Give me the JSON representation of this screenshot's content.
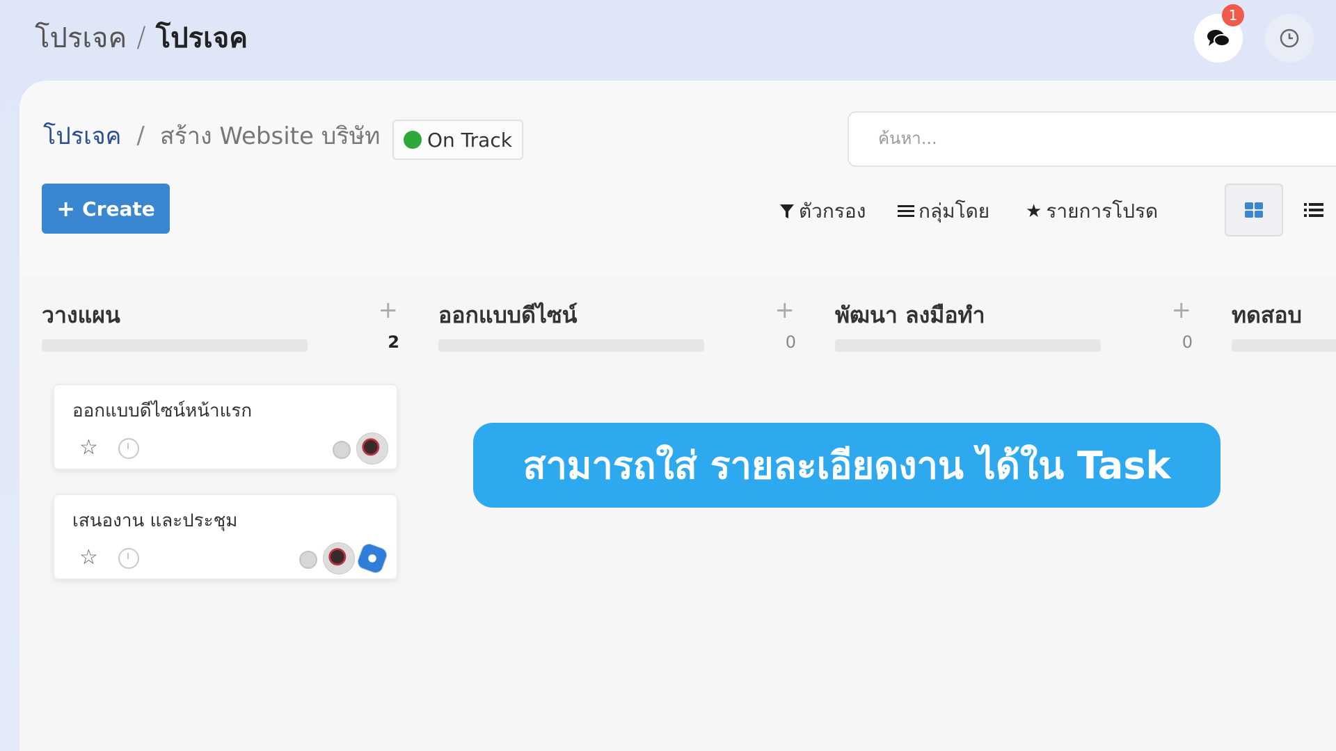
{
  "header": {
    "breadcrumb_parent": "โปรเจค",
    "breadcrumb_current": "โปรเจค",
    "notification_count": "1"
  },
  "project": {
    "breadcrumb_root": "โปรเจค",
    "name": "สร้าง Website บริษัท",
    "status": "On Track",
    "status_color": "#2fa83a"
  },
  "search": {
    "placeholder": "ค้นหา..."
  },
  "toolbar": {
    "create_label": "Create",
    "filter_label": "ตัวกรอง",
    "groupby_label": "กลุ่มโดย",
    "favorites_label": "รายการโปรด"
  },
  "columns": [
    {
      "title": "วางแผน",
      "count": "2"
    },
    {
      "title": "ออกแบบดีไซน์",
      "count": "0"
    },
    {
      "title": "พัฒนา ลงมือทำ",
      "count": "0"
    },
    {
      "title": "ทดสอบ"
    }
  ],
  "cards": [
    {
      "title": "ออกแบบดีไซน์หน้าแรก"
    },
    {
      "title": "เสนองาน และประชุม"
    }
  ],
  "caption": "สามารถใส่ รายละเอียดงาน ได้ใน Task",
  "colors": {
    "accent": "#3b86d1",
    "caption_bg": "#2ea9ef",
    "badge": "#f05a4a"
  }
}
